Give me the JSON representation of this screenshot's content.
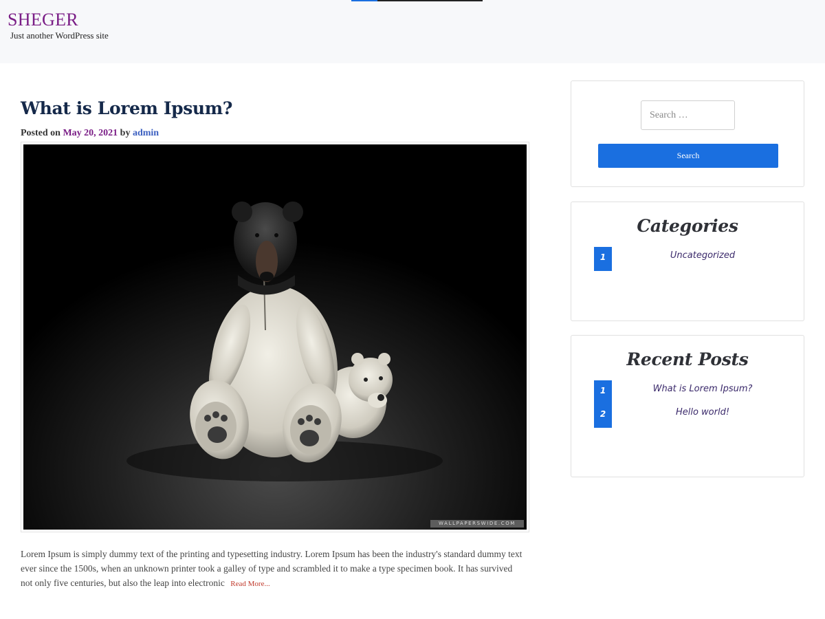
{
  "site": {
    "title": "SHEGER",
    "tagline": "Just another WordPress site"
  },
  "post": {
    "title": "What is Lorem Ipsum?",
    "meta_prefix": "Posted on ",
    "date": "May 20, 2021",
    "meta_by": " by ",
    "author": "admin",
    "image_watermark": "WALLPAPERSWIDE.COM",
    "excerpt": "Lorem Ipsum is simply dummy text of the printing and typesetting industry. Lorem Ipsum has been the industry's standard dummy text ever since the 1500s, when an unknown printer took a galley of type and scrambled it to make a type specimen book. It has survived not only five centuries, but also the leap into electronic",
    "read_more": "Read More..."
  },
  "sidebar": {
    "search": {
      "placeholder": "Search …",
      "button_label": "Search"
    },
    "categories": {
      "title": "Categories",
      "items": [
        {
          "num": "1",
          "label": "Uncategorized"
        }
      ]
    },
    "recent_posts": {
      "title": "Recent Posts",
      "items": [
        {
          "num": "1",
          "label": "What is Lorem Ipsum?"
        },
        {
          "num": "2",
          "label": "Hello world!"
        }
      ]
    }
  },
  "colors": {
    "accent": "#1a6fe0",
    "site_title": "#7a1d86",
    "post_title": "#15294a",
    "header_bg": "#f7f8fa"
  }
}
